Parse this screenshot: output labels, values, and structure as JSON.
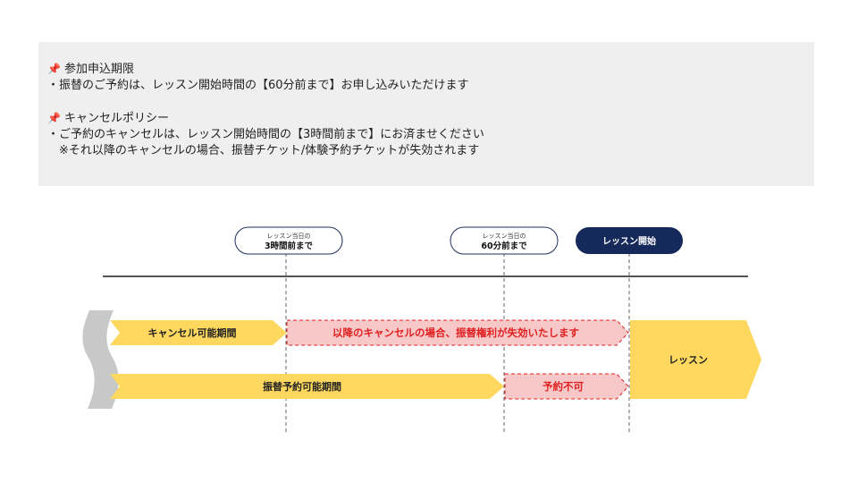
{
  "policy": {
    "deadline_title": "参加申込期限",
    "deadline_text": "・振替のご予約は、レッスン開始時間の【60分前まで】お申し込みいただけます",
    "cancel_title": "キャンセルポリシー",
    "cancel_text": "・ご予約のキャンセルは、レッスン開始時間の【3時間前まで】にお済ませください",
    "cancel_note": "　※それ以降のキャンセルの場合、振替チケット/体験予約チケットが失効されます"
  },
  "timeline": {
    "marker_3h": {
      "small": "レッスン当日の",
      "main": "3時間前まで"
    },
    "marker_60m": {
      "small": "レッスン当日の",
      "main": "60分前まで"
    },
    "marker_start": {
      "main": "レッスン開始"
    }
  },
  "bars": {
    "cancel_period": "キャンセル可能期間",
    "cancel_after": "以降のキャンセルの場合、振替権利が失効いたします",
    "transfer_period": "振替予約可能期間",
    "no_booking": "予約不可",
    "lesson": "レッスン"
  },
  "colors": {
    "yellow": "#fdd75e",
    "pink": "#f8c8c8",
    "red": "#e02020",
    "navy": "#15295a",
    "gray": "#c8c8c8"
  }
}
